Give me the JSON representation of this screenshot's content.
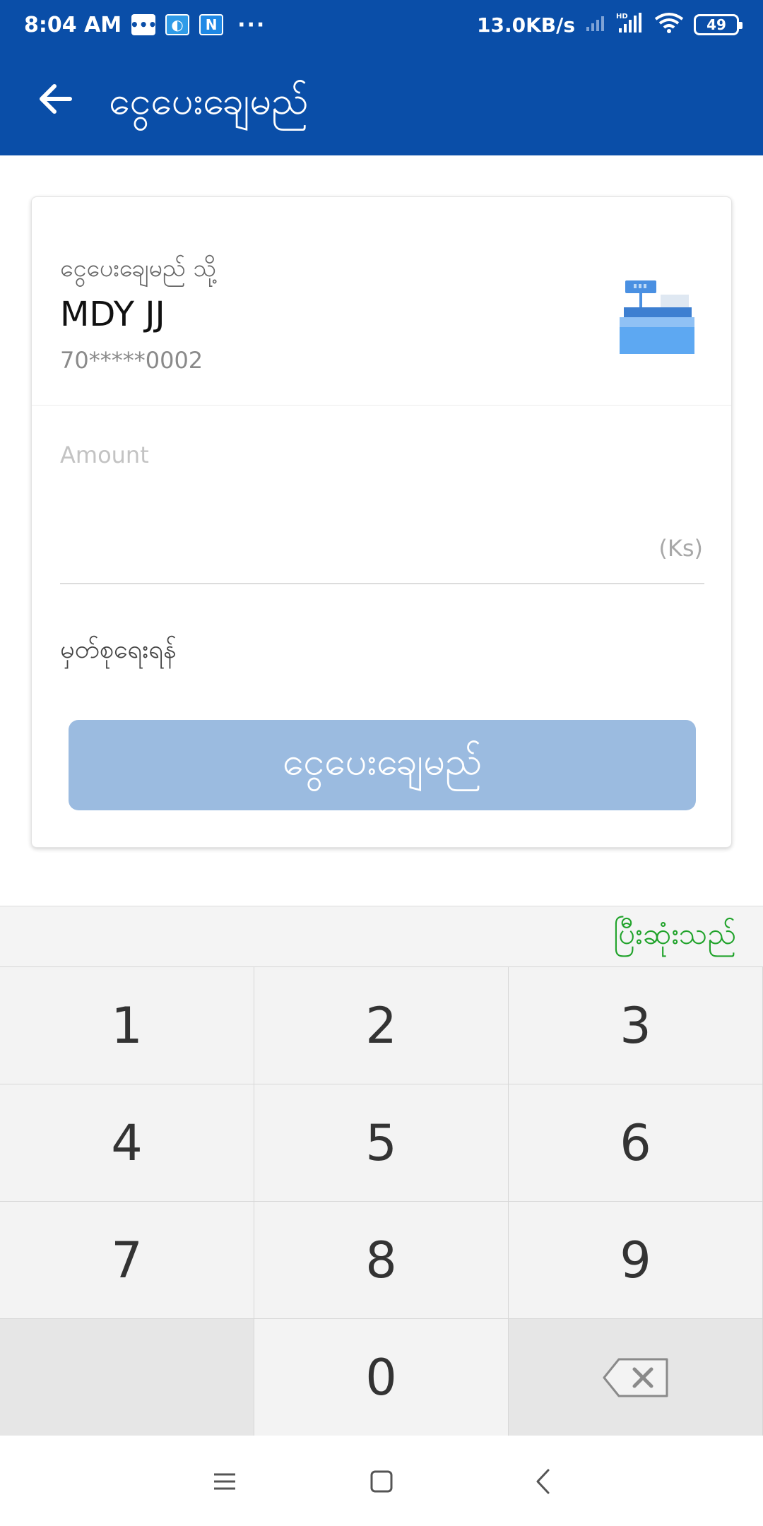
{
  "status_bar": {
    "time": "8:04 AM",
    "network_speed": "13.0KB/s",
    "network_type": "HD",
    "battery": "49",
    "icons": [
      "message-icon",
      "app-notification-icon",
      "n-app-icon",
      "more-notifications-icon",
      "signal-weak-icon",
      "signal-icon",
      "wifi-icon",
      "battery-icon"
    ],
    "more": "···"
  },
  "app_bar": {
    "title": "ငွေပေးချေမည်",
    "back_icon": "arrow-left-icon"
  },
  "recipient": {
    "to_label": "ငွေပေးချေမည် သို့",
    "name": "MDY JJ",
    "phone": "70*****0002",
    "icon": "cash-register-icon"
  },
  "amount": {
    "placeholder": "Amount",
    "value": "",
    "currency": "(Ks)"
  },
  "note": {
    "label": "မှတ်စုရေးရန်"
  },
  "pay_button": {
    "label": "ငွေပေးချေမည်"
  },
  "keypad": {
    "done_label": "ပြီးဆုံးသည်",
    "keys": [
      "1",
      "2",
      "3",
      "4",
      "5",
      "6",
      "7",
      "8",
      "9",
      "",
      "0",
      "⌫"
    ],
    "backspace_icon": "backspace-icon"
  },
  "nav_bar": {
    "icons": [
      "menu-icon",
      "home-icon",
      "back-icon"
    ]
  },
  "colors": {
    "primary": "#0a4ea8",
    "button_disabled": "#9bbbe0",
    "done_green": "#21a32b",
    "keypad_bg": "#f3f3f3"
  }
}
